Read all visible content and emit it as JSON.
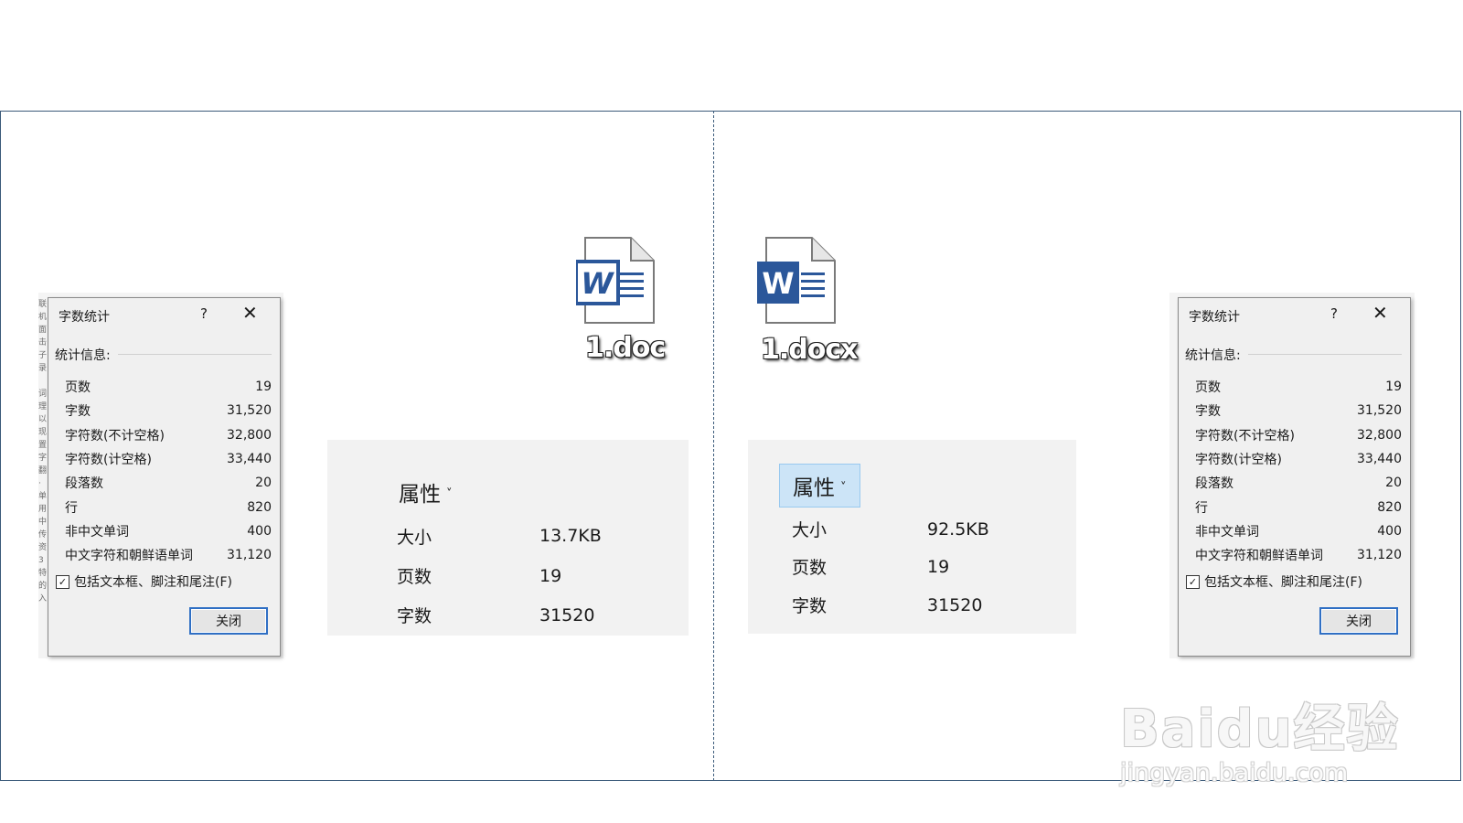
{
  "left_dialog": {
    "title": "字数统计",
    "help": "?",
    "close_glyph": "✕",
    "section": "统计信息:",
    "rows": [
      {
        "label": "页数",
        "value": "19"
      },
      {
        "label": "字数",
        "value": "31,520"
      },
      {
        "label": "字符数(不计空格)",
        "value": "32,800"
      },
      {
        "label": "字符数(计空格)",
        "value": "33,440"
      },
      {
        "label": "段落数",
        "value": "20"
      },
      {
        "label": "行",
        "value": "820"
      },
      {
        "label": "非中文单词",
        "value": "400"
      },
      {
        "label": "中文字符和朝鲜语单词",
        "value": "31,120"
      }
    ],
    "checkbox_label": "包括文本框、脚注和尾注(F)",
    "checked": true,
    "close_button": "关闭"
  },
  "right_dialog": {
    "title": "字数统计",
    "help": "?",
    "close_glyph": "✕",
    "section": "统计信息:",
    "rows": [
      {
        "label": "页数",
        "value": "19"
      },
      {
        "label": "字数",
        "value": "31,520"
      },
      {
        "label": "字符数(不计空格)",
        "value": "32,800"
      },
      {
        "label": "字符数(计空格)",
        "value": "33,440"
      },
      {
        "label": "段落数",
        "value": "20"
      },
      {
        "label": "行",
        "value": "820"
      },
      {
        "label": "非中文单词",
        "value": "400"
      },
      {
        "label": "中文字符和朝鲜语单词",
        "value": "31,120"
      }
    ],
    "checkbox_label": "包括文本框、脚注和尾注(F)",
    "checked": true,
    "close_button": "关闭"
  },
  "files": {
    "doc": {
      "name": "1.doc",
      "icon": "word-doc-icon"
    },
    "docx": {
      "name": "1.docx",
      "icon": "word-docx-icon"
    }
  },
  "doc_properties": {
    "header": "属性",
    "rows": [
      {
        "label": "大小",
        "value": "13.7KB"
      },
      {
        "label": "页数",
        "value": "19"
      },
      {
        "label": "字数",
        "value": "31520"
      }
    ]
  },
  "docx_properties": {
    "header": "属性",
    "rows": [
      {
        "label": "大小",
        "value": "92.5KB"
      },
      {
        "label": "页数",
        "value": "19"
      },
      {
        "label": "字数",
        "value": "31520"
      }
    ]
  },
  "watermark": {
    "brand": "Baidu经验",
    "url": "jingyan.baidu.com"
  },
  "colors": {
    "word_blue": "#2b579a",
    "frame_border": "#3b5a7a",
    "selected_bg": "#cce4f7"
  }
}
